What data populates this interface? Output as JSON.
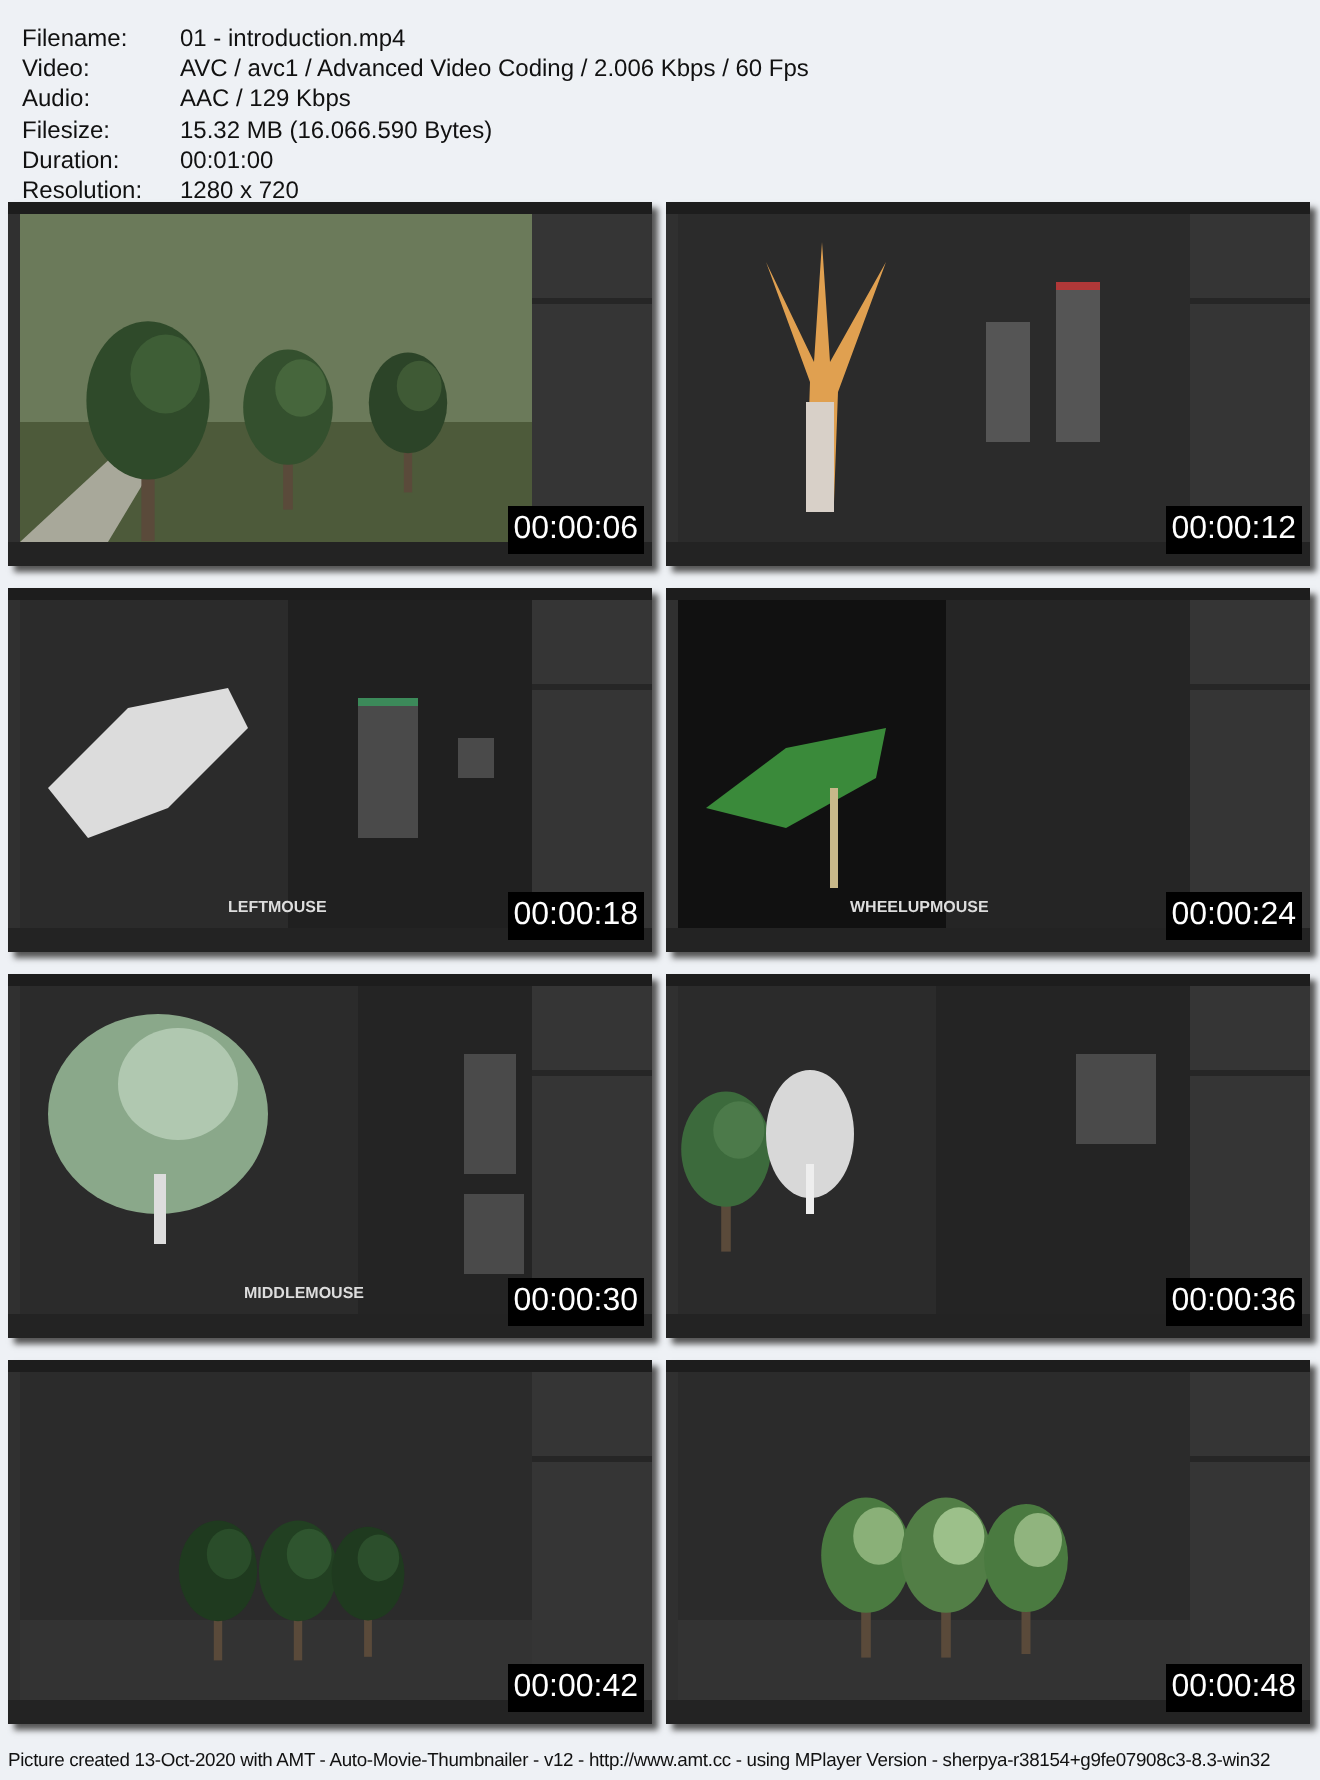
{
  "info": [
    {
      "label": "Filename:",
      "value": "01 - introduction.mp4"
    },
    {
      "label": "Video:",
      "value": "AVC / avc1 / Advanced Video Coding / 2.006 Kbps / 60 Fps"
    },
    {
      "label": "Audio:",
      "value": "AAC / 129 Kbps"
    },
    {
      "label": "Filesize:",
      "value": "15.32 MB (16.066.590 Bytes)"
    },
    {
      "label": "Duration:",
      "value": "00:01:00"
    },
    {
      "label": "Resolution:",
      "value": "1280 x 720"
    }
  ],
  "frames": [
    {
      "kind": "picture",
      "timestamp": "00:00:06"
    },
    {
      "kind": "picture",
      "timestamp": "00:00:12"
    },
    {
      "kind": "picture",
      "timestamp": "00:00:18",
      "key_hint": "LEFTMOUSE"
    },
    {
      "kind": "picture",
      "timestamp": "00:00:24",
      "key_hint": "WHEELUPMOUSE"
    },
    {
      "kind": "picture",
      "timestamp": "00:00:30",
      "key_hint": "MIDDLEMOUSE"
    },
    {
      "kind": "picture",
      "timestamp": "00:00:36"
    },
    {
      "kind": "picture",
      "timestamp": "00:00:42"
    },
    {
      "kind": "picture",
      "timestamp": "00:00:48"
    }
  ],
  "footer": "Picture created 13-Oct-2020 with AMT - Auto-Movie-Thumbnailer - v12 - http://www.amt.cc - using MPlayer Version - sherpya-r38154+g9fe07908c3-8.3-win32"
}
